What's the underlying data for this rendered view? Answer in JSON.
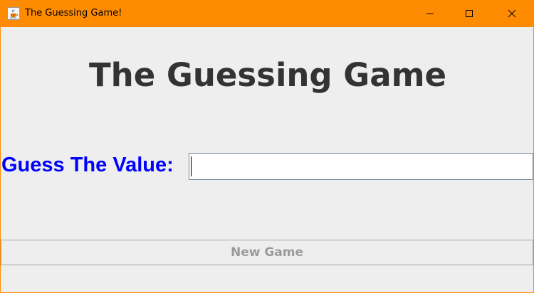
{
  "window": {
    "title": "The Guessing Game!",
    "accent_color": "#ff8c00",
    "icon": "java-cup-icon",
    "controls": {
      "minimize_icon": "minimize-icon",
      "maximize_icon": "maximize-icon",
      "close_icon": "close-icon"
    }
  },
  "main": {
    "heading": "The Guessing Game",
    "heading_color": "#333333",
    "guess_label": "Guess The Value:",
    "guess_label_color": "#0000ff",
    "guess_input_value": "",
    "new_game_label": "New Game",
    "new_game_enabled": false
  }
}
